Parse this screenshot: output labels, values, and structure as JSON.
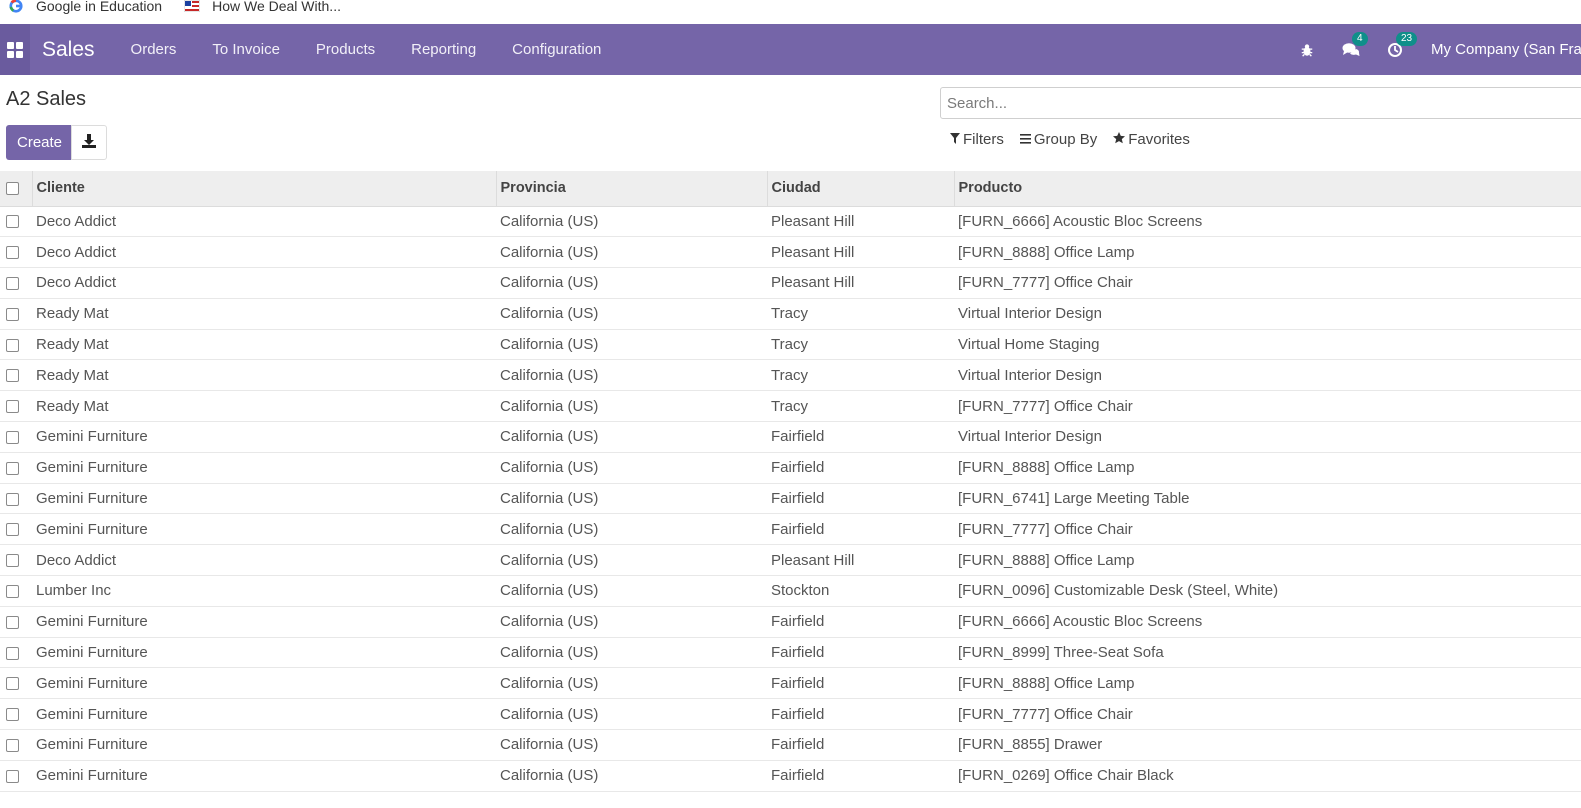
{
  "bookmarks": [
    {
      "label": "Google in Education",
      "icon": "google-icon"
    },
    {
      "label": "How We Deal With...",
      "icon": "flag-icon"
    }
  ],
  "navbar": {
    "app_name": "Sales",
    "menu": [
      "Orders",
      "To Invoice",
      "Products",
      "Reporting",
      "Configuration"
    ],
    "messages_count": "4",
    "activities_count": "23",
    "company": "My Company (San Francisco)"
  },
  "control_panel": {
    "title": "A2 Sales",
    "create_label": "Create",
    "search_placeholder": "Search...",
    "filters_label": "Filters",
    "group_by_label": "Group By",
    "favorites_label": "Favorites"
  },
  "table": {
    "columns": [
      "Cliente",
      "Provincia",
      "Ciudad",
      "Producto"
    ],
    "rows": [
      [
        "Deco Addict",
        "California (US)",
        "Pleasant Hill",
        "[FURN_6666] Acoustic Bloc Screens"
      ],
      [
        "Deco Addict",
        "California (US)",
        "Pleasant Hill",
        "[FURN_8888] Office Lamp"
      ],
      [
        "Deco Addict",
        "California (US)",
        "Pleasant Hill",
        "[FURN_7777] Office Chair"
      ],
      [
        "Ready Mat",
        "California (US)",
        "Tracy",
        "Virtual Interior Design"
      ],
      [
        "Ready Mat",
        "California (US)",
        "Tracy",
        "Virtual Home Staging"
      ],
      [
        "Ready Mat",
        "California (US)",
        "Tracy",
        "Virtual Interior Design"
      ],
      [
        "Ready Mat",
        "California (US)",
        "Tracy",
        "[FURN_7777] Office Chair"
      ],
      [
        "Gemini Furniture",
        "California (US)",
        "Fairfield",
        "Virtual Interior Design"
      ],
      [
        "Gemini Furniture",
        "California (US)",
        "Fairfield",
        "[FURN_8888] Office Lamp"
      ],
      [
        "Gemini Furniture",
        "California (US)",
        "Fairfield",
        "[FURN_6741] Large Meeting Table"
      ],
      [
        "Gemini Furniture",
        "California (US)",
        "Fairfield",
        "[FURN_7777] Office Chair"
      ],
      [
        "Deco Addict",
        "California (US)",
        "Pleasant Hill",
        "[FURN_8888] Office Lamp"
      ],
      [
        "Lumber Inc",
        "California (US)",
        "Stockton",
        "[FURN_0096] Customizable Desk (Steel, White)"
      ],
      [
        "Gemini Furniture",
        "California (US)",
        "Fairfield",
        "[FURN_6666] Acoustic Bloc Screens"
      ],
      [
        "Gemini Furniture",
        "California (US)",
        "Fairfield",
        "[FURN_8999] Three-Seat Sofa"
      ],
      [
        "Gemini Furniture",
        "California (US)",
        "Fairfield",
        "[FURN_8888] Office Lamp"
      ],
      [
        "Gemini Furniture",
        "California (US)",
        "Fairfield",
        "[FURN_7777] Office Chair"
      ],
      [
        "Gemini Furniture",
        "California (US)",
        "Fairfield",
        "[FURN_8855] Drawer"
      ],
      [
        "Gemini Furniture",
        "California (US)",
        "Fairfield",
        "[FURN_0269] Office Chair Black"
      ]
    ]
  },
  "colors": {
    "navbar": "#7565a8",
    "primary_button": "#7565a8",
    "badge": "#0f8f8a",
    "header_row": "#eeeeee"
  }
}
